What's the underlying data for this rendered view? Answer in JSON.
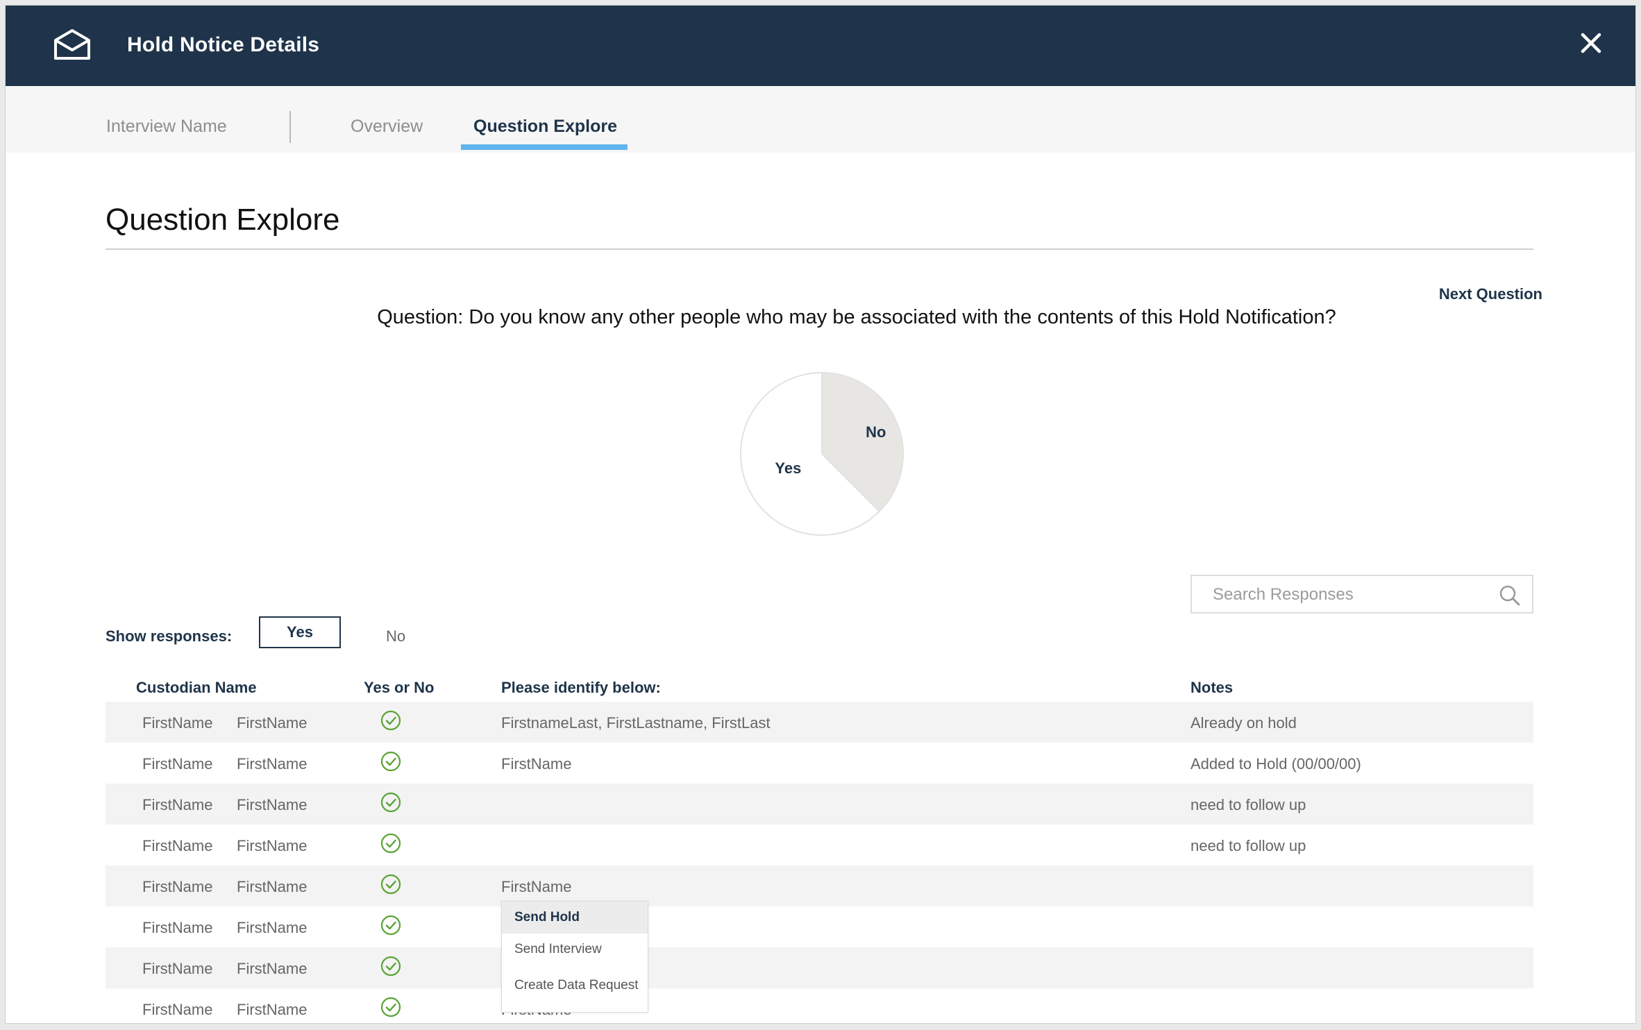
{
  "header": {
    "title": "Hold Notice Details"
  },
  "tabs": [
    {
      "label": "Interview Name"
    },
    {
      "label": "Overview"
    },
    {
      "label": "Question Explore"
    }
  ],
  "section": {
    "title": "Question Explore"
  },
  "next_question_label": "Next Question",
  "question_text": "Question: Do you know any other people who may be associated with the contents of this Hold Notification?",
  "chart_data": {
    "type": "pie",
    "slices": [
      {
        "label": "Yes",
        "value": 62.5,
        "color": "#ffffff"
      },
      {
        "label": "No",
        "value": 37.5,
        "color": "#e8e6e3"
      }
    ]
  },
  "search": {
    "placeholder": "Search Responses"
  },
  "filter": {
    "label": "Show responses:",
    "options": [
      "Yes",
      "No"
    ],
    "selected": "Yes"
  },
  "table": {
    "columns": [
      "Custodian Name",
      "Yes or No",
      "Please identify below:",
      "Notes"
    ],
    "rows": [
      {
        "first": "FirstName",
        "last": "FirstName",
        "identify": "FirstnameLast, FirstLastname, FirstLast",
        "notes": "Already on hold"
      },
      {
        "first": "FirstName",
        "last": "FirstName",
        "identify": "FirstName",
        "notes": "Added to Hold (00/00/00)"
      },
      {
        "first": "FirstName",
        "last": "FirstName",
        "identify": "",
        "notes": "need to follow up"
      },
      {
        "first": "FirstName",
        "last": "FirstName",
        "identify": "",
        "notes": "need to follow up"
      },
      {
        "first": "FirstName",
        "last": "FirstName",
        "identify": "FirstName",
        "notes": ""
      },
      {
        "first": "FirstName",
        "last": "FirstName",
        "identify": "",
        "notes": ""
      },
      {
        "first": "FirstName",
        "last": "FirstName",
        "identify": "",
        "notes": ""
      },
      {
        "first": "FirstName",
        "last": "FirstName",
        "identify": "FirstName",
        "notes": ""
      }
    ]
  },
  "context_menu": {
    "items": [
      "Send Hold",
      "Send Interview",
      "Create Data Request"
    ]
  },
  "colors": {
    "header": "#1f344a",
    "tab_underline": "#60b4ee",
    "check": "#5aa336",
    "pie_no": "#e8e6e3"
  }
}
